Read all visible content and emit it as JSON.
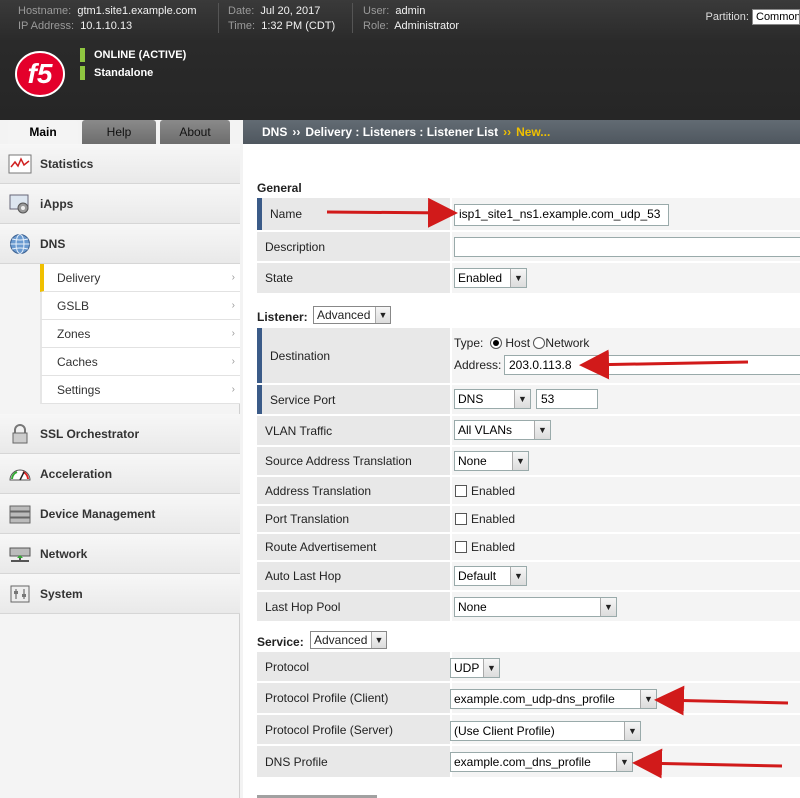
{
  "header": {
    "hostname_label": "Hostname:",
    "hostname": "gtm1.site1.example.com",
    "ip_label": "IP Address:",
    "ip": "10.1.10.13",
    "date_label": "Date:",
    "date": "Jul 20, 2017",
    "time_label": "Time:",
    "time": "1:32 PM (CDT)",
    "user_label": "User:",
    "user": "admin",
    "role_label": "Role:",
    "role": "Administrator",
    "partition_label": "Partition:",
    "partition": "Common",
    "status": "ONLINE (ACTIVE)",
    "mode": "Standalone",
    "logo_text": "f5"
  },
  "tabs": [
    {
      "label": "Main",
      "active": true
    },
    {
      "label": "Help",
      "active": false
    },
    {
      "label": "About",
      "active": false
    }
  ],
  "breadcrumb": {
    "items": [
      "DNS",
      "Delivery : Listeners : Listener List"
    ],
    "separator": "››",
    "current": "New..."
  },
  "sidebar": {
    "sections": [
      {
        "label": "Statistics",
        "icon": "statistics-icon"
      },
      {
        "label": "iApps",
        "icon": "iapps-icon"
      },
      {
        "label": "DNS",
        "icon": "dns-globe-icon"
      },
      {
        "label": "SSL Orchestrator",
        "icon": "lock-icon"
      },
      {
        "label": "Acceleration",
        "icon": "gauge-icon"
      },
      {
        "label": "Device Management",
        "icon": "device-icon"
      },
      {
        "label": "Network",
        "icon": "network-icon"
      },
      {
        "label": "System",
        "icon": "system-icon"
      }
    ],
    "dns_items": [
      {
        "label": "Delivery",
        "active": true
      },
      {
        "label": "GSLB",
        "active": false
      },
      {
        "label": "Zones",
        "active": false
      },
      {
        "label": "Caches",
        "active": false
      },
      {
        "label": "Settings",
        "active": false
      }
    ],
    "chevron": "›"
  },
  "form": {
    "general": {
      "title": "General",
      "name_label": "Name",
      "name_value": "isp1_site1_ns1.example.com_udp_53",
      "description_label": "Description",
      "description_value": "",
      "state_label": "State",
      "state_value": "Enabled"
    },
    "listener": {
      "title": "Listener:",
      "mode": "Advanced",
      "destination_label": "Destination",
      "type_label": "Type:",
      "type_host": "Host",
      "type_network": "Network",
      "type_selected": "Host",
      "address_label": "Address:",
      "address_value": "203.0.113.8",
      "service_port_label": "Service Port",
      "service_port_select": "DNS",
      "service_port_value": "53",
      "vlan_label": "VLAN Traffic",
      "vlan_value": "All VLANs",
      "snat_label": "Source Address Translation",
      "snat_value": "None",
      "addr_trans_label": "Address Translation",
      "addr_trans_check": "Enabled",
      "port_trans_label": "Port Translation",
      "port_trans_check": "Enabled",
      "route_adv_label": "Route Advertisement",
      "route_adv_check": "Enabled",
      "auto_last_hop_label": "Auto Last Hop",
      "auto_last_hop_value": "Default",
      "last_hop_pool_label": "Last Hop Pool",
      "last_hop_pool_value": "None"
    },
    "service": {
      "title": "Service:",
      "mode": "Advanced",
      "protocol_label": "Protocol",
      "protocol_value": "UDP",
      "client_profile_label": "Protocol Profile (Client)",
      "client_profile_value": "example.com_udp-dns_profile",
      "server_profile_label": "Protocol Profile (Server)",
      "server_profile_value": "(Use Client Profile)",
      "dns_profile_label": "DNS Profile",
      "dns_profile_value": "example.com_dns_profile"
    }
  },
  "colors": {
    "annotation_arrow": "#d11a1a",
    "status_green": "#8fc640",
    "active_yellow": "#f0c000",
    "f5_red": "#e4002b"
  }
}
